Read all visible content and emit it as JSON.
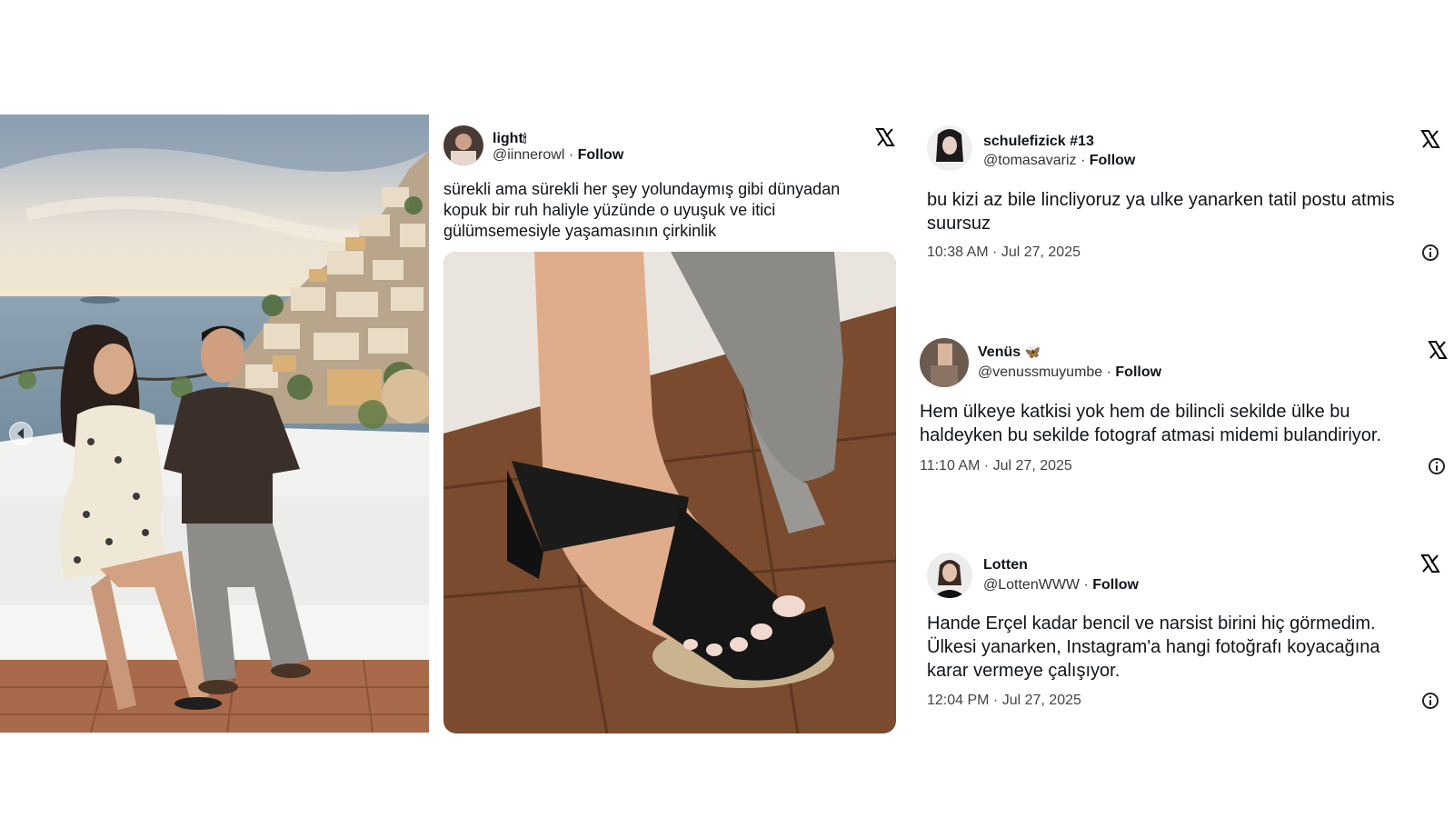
{
  "tweets": [
    {
      "name": "light",
      "name_emoji": "🕯",
      "handle": "@iinnerowl",
      "follow": "Follow",
      "text_lines": [
        "sürekli ama sürekli her şey yolundaymış gibi dünyadan",
        "kopuk bir ruh haliyle yüzünde o uyuşuk ve itici",
        "gülümsemesiyle yaşamasının çirkinlik"
      ]
    },
    {
      "name": "schulefizick #13",
      "handle": "@tomasavariz",
      "follow": "Follow",
      "text_lines": [
        "bu kizi az bile lincliyoruz ya ulke yanarken tatil postu atmis",
        "suursuz"
      ],
      "time": "10:38 AM · Jul 27, 2025"
    },
    {
      "name": "Venüs",
      "name_emoji": "🦋",
      "handle": "@venussmuyumbe",
      "follow": "Follow",
      "text_lines": [
        "Hem ülkeye katkisi yok hem de bilincli sekilde  ülke bu",
        "haldeyken bu sekilde fotograf atmasi midemi bulandiriyor."
      ],
      "time": "11:10 AM · Jul 27, 2025"
    },
    {
      "name": "Lotten",
      "handle": "@LottenWWW",
      "follow": "Follow",
      "text_lines": [
        "Hande Erçel kadar bencil ve narsist birini hiç görmedim.",
        "Ülkesi yanarken, Instagram'a hangi fotoğrafı koyacağına",
        "karar vermeye çalışıyor."
      ],
      "time": "12:04 PM · Jul 27, 2025"
    }
  ],
  "icons": {
    "x_logo": "x-logo-icon",
    "info": "info-icon",
    "gallery_prev": "chevron-left-icon"
  },
  "colors": {
    "text": "#0f1419",
    "secondary": "#444444",
    "background": "#ffffff"
  }
}
